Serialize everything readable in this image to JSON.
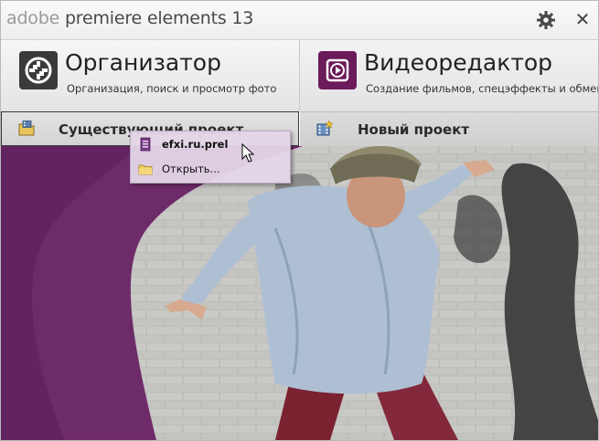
{
  "window": {
    "title_light": "adobe",
    "title_main": "premiere elements 13"
  },
  "titlebar": {
    "settings_icon": "gear-icon",
    "close_icon": "close-icon",
    "close_glyph": "✕"
  },
  "modes": {
    "organizer": {
      "title": "Организатор",
      "subtitle": "Организация, поиск и просмотр фото",
      "icon": "organizer-icon"
    },
    "video_editor": {
      "title": "Видеоредактор",
      "subtitle": "Создание фильмов, спецэффекты и обмен",
      "icon": "video-editor-icon"
    }
  },
  "projects": {
    "existing_label": "Существующий проект",
    "new_label": "Новый проект"
  },
  "recent_menu": {
    "items": [
      {
        "label": "efxi.ru.prel",
        "icon": "project-file-icon"
      },
      {
        "label": "Открыть...",
        "icon": "folder-icon"
      }
    ]
  },
  "colors": {
    "accent_purple": "#6b1a5a",
    "photo_purple": "#6e2b6a",
    "menu_bg": "#e4d6e8"
  }
}
